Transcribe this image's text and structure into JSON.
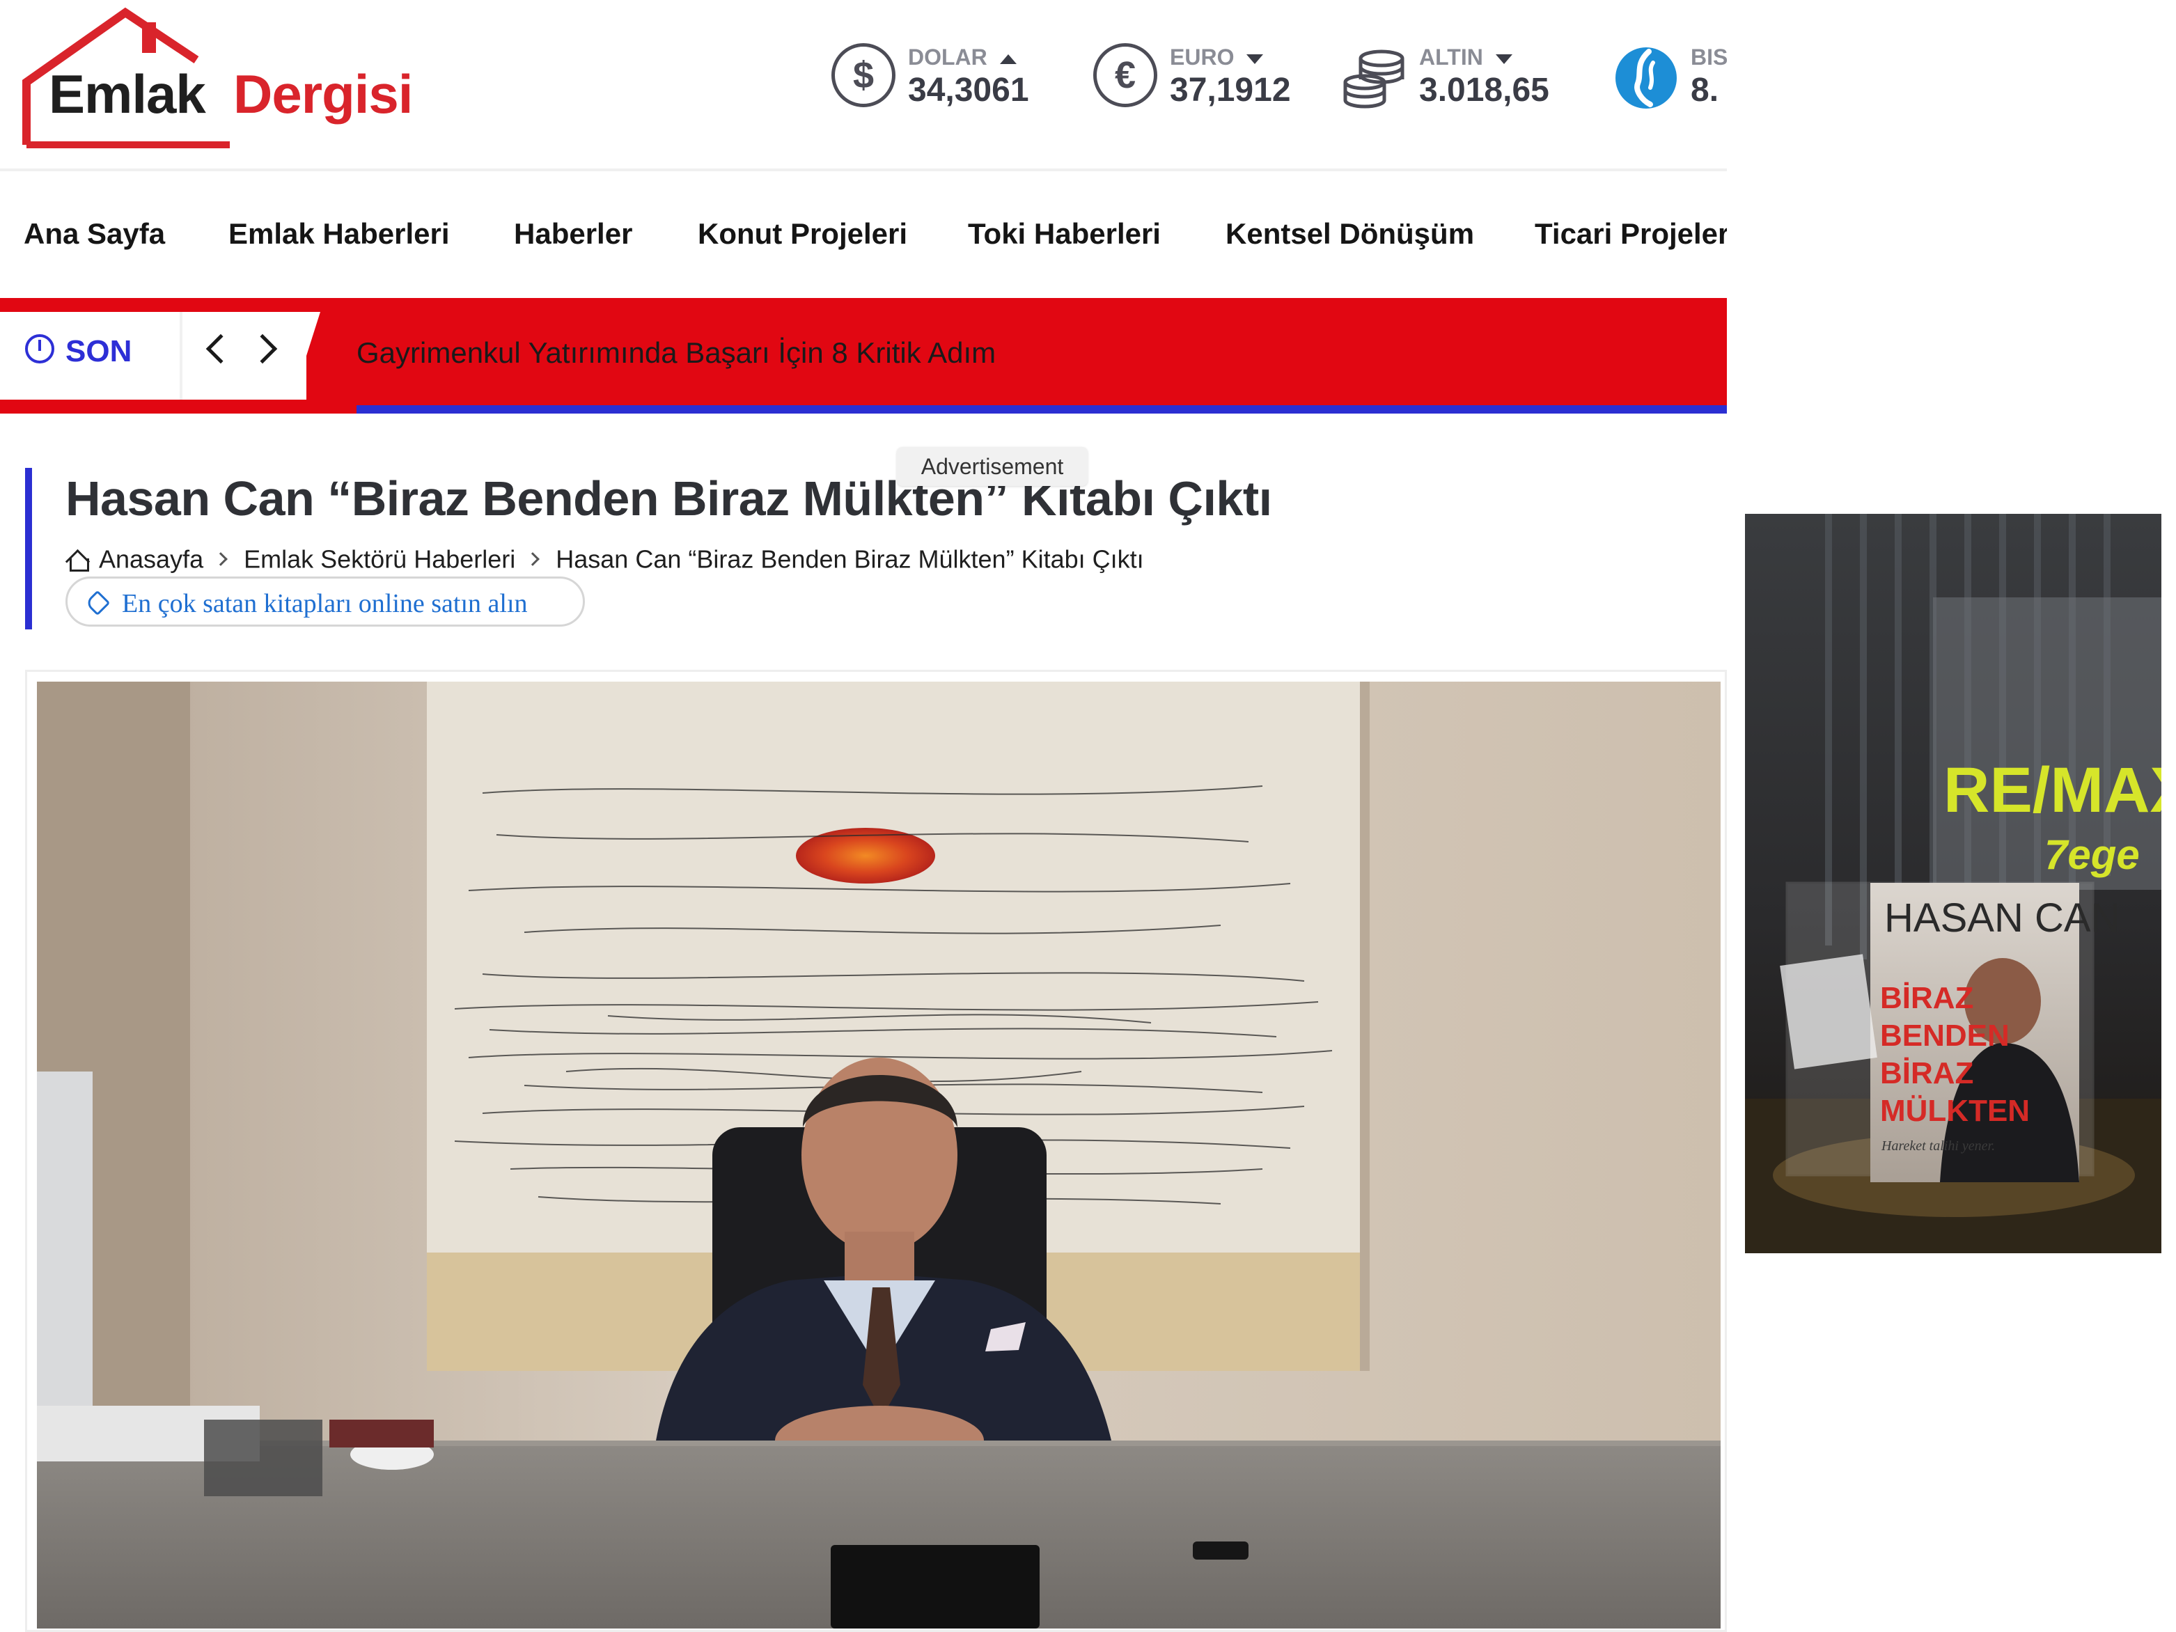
{
  "site": {
    "logo": {
      "word1": "Emlak",
      "word2": "Dergisi"
    },
    "rates": [
      {
        "name": "DOLAR",
        "value": "34,3061",
        "trend": "up",
        "icon": "dollar-icon",
        "symbol": "$"
      },
      {
        "name": "EURO",
        "value": "37,1912",
        "trend": "down",
        "icon": "euro-icon",
        "symbol": "€"
      },
      {
        "name": "ALTIN",
        "value": "3.018,65",
        "trend": "down",
        "icon": "gold-coins-icon",
        "symbol": ""
      },
      {
        "name": "BIS",
        "value": "8.",
        "trend": "",
        "icon": "borsa-istanbul-icon",
        "symbol": ""
      }
    ],
    "nav": [
      "Ana Sayfa",
      "Emlak Haberleri",
      "Haberler",
      "Konut Projeleri",
      "Toki Haberleri",
      "Kentsel Dönüşüm",
      "Ticari Projeler"
    ],
    "ticker": {
      "label": "SON",
      "headline": "Gayrimenkul Yatırımında Başarı İçin 8 Kritik Adım"
    }
  },
  "article": {
    "title": "Hasan Can “Biraz Benden Biraz Mülkten” Kitabı Çıktı",
    "breadcrumb": [
      "Anasayfa",
      "Emlak Sektörü Haberleri",
      "Hasan Can “Biraz Benden Biraz Mülkten” Kitabı Çıktı"
    ],
    "shop_link": "En çok satan kitapları online satın alın",
    "ad_label": "Advertisement"
  },
  "side_ad": {
    "brand": "RE/MAX",
    "brand_sub": "7ege",
    "book": {
      "author": "HASAN CAN",
      "title_lines": [
        "BİRAZ",
        "BENDEN",
        "BİRAZ",
        "MÜLKTEN"
      ],
      "tagline": "Hareket talihi yener."
    }
  },
  "colors": {
    "brand_red": "#e10712",
    "accent_blue": "#2b2fd2",
    "logo_red": "#d9242b",
    "link_blue": "#1f6fd1"
  }
}
